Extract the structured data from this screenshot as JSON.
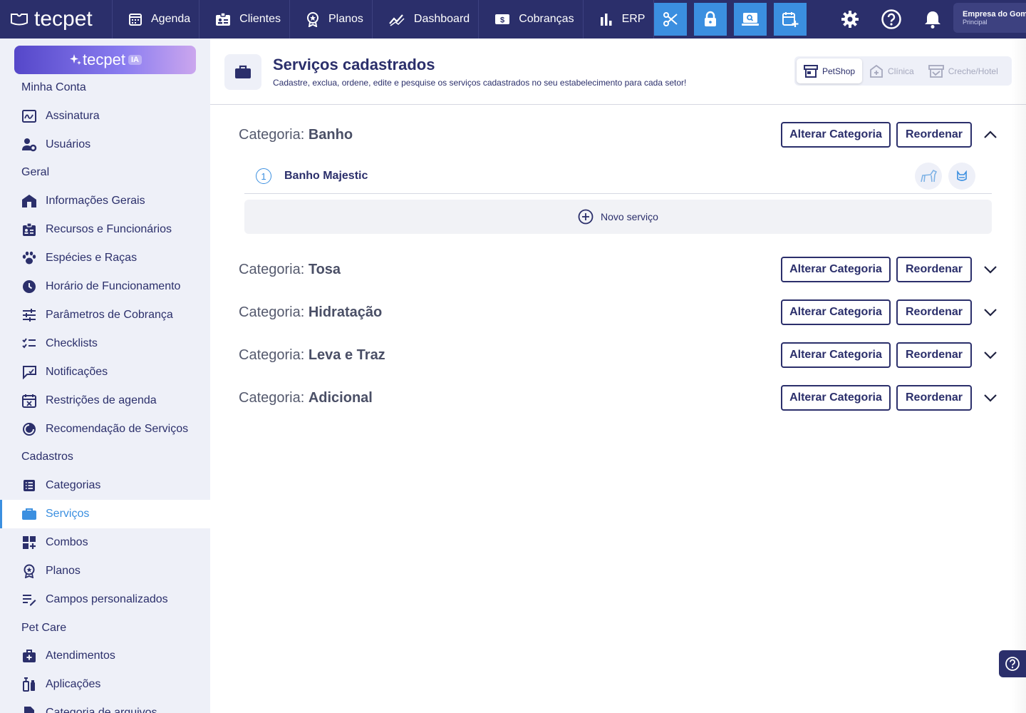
{
  "app": {
    "logo_text": "tecpet"
  },
  "topnav": {
    "items": [
      {
        "label": "Agenda",
        "icon": "calendar-icon"
      },
      {
        "label": "Clientes",
        "icon": "id-card-icon"
      },
      {
        "label": "Planos",
        "icon": "medal-icon"
      },
      {
        "label": "Dashboard",
        "icon": "chart-line-icon"
      },
      {
        "label": "Cobranças",
        "icon": "money-icon"
      },
      {
        "label": "ERP",
        "icon": "bar-chart-icon"
      }
    ],
    "quick_actions": [
      "scissors-icon",
      "lock-icon",
      "screen-search-icon",
      "calendar-plus-icon"
    ],
    "company_name": "Empresa do Gomes",
    "company_sub": "Principal"
  },
  "sidebar": {
    "ia_label": "tecpet",
    "ia_badge": "IA",
    "sections": {
      "minha_conta": "Minha Conta",
      "geral": "Geral",
      "cadastros": "Cadastros",
      "pet_care": "Pet Care"
    },
    "items": {
      "assinatura": "Assinatura",
      "usuarios": "Usuários",
      "info_gerais": "Informações Gerais",
      "recursos": "Recursos e Funcionários",
      "especies": "Espécies e Raças",
      "horario": "Horário de Funcionamento",
      "parametros": "Parâmetros de Cobrança",
      "checklists": "Checklists",
      "notificacoes": "Notificações",
      "restricoes": "Restrições de agenda",
      "recomendacao": "Recomendação de Serviços",
      "categorias": "Categorias",
      "servicos": "Serviços",
      "combos": "Combos",
      "planos": "Planos",
      "campos": "Campos personalizados",
      "atendimentos": "Atendimentos",
      "aplicacoes": "Aplicações",
      "categoria_arquivos": "Categoria de arquivos"
    }
  },
  "page": {
    "title": "Serviços cadastrados",
    "subtitle": "Cadastre, exclua, ordene, edite e pesquise os serviços cadastrados no seu estabelecimento para cada setor!",
    "sectors": [
      {
        "label": "PetShop",
        "active": true
      },
      {
        "label": "Clínica",
        "active": false
      },
      {
        "label": "Creche/Hotel",
        "active": false
      }
    ]
  },
  "categories": {
    "prefix": "Categoria:",
    "alter_label": "Alterar Categoria",
    "reorder_label": "Reordenar",
    "list": [
      {
        "name": "Banho",
        "expanded": true
      },
      {
        "name": "Tosa",
        "expanded": false
      },
      {
        "name": "Hidratação",
        "expanded": false
      },
      {
        "name": "Leva e Traz",
        "expanded": false
      },
      {
        "name": "Adicional",
        "expanded": false
      }
    ]
  },
  "services": {
    "items": [
      {
        "order": "1",
        "name": "Banho Majestic"
      }
    ],
    "new_label": "Novo serviço"
  },
  "colors": {
    "navy": "#2b2f6b",
    "accent": "#3b8fe0",
    "sidebar_bg": "#eef0f8"
  }
}
